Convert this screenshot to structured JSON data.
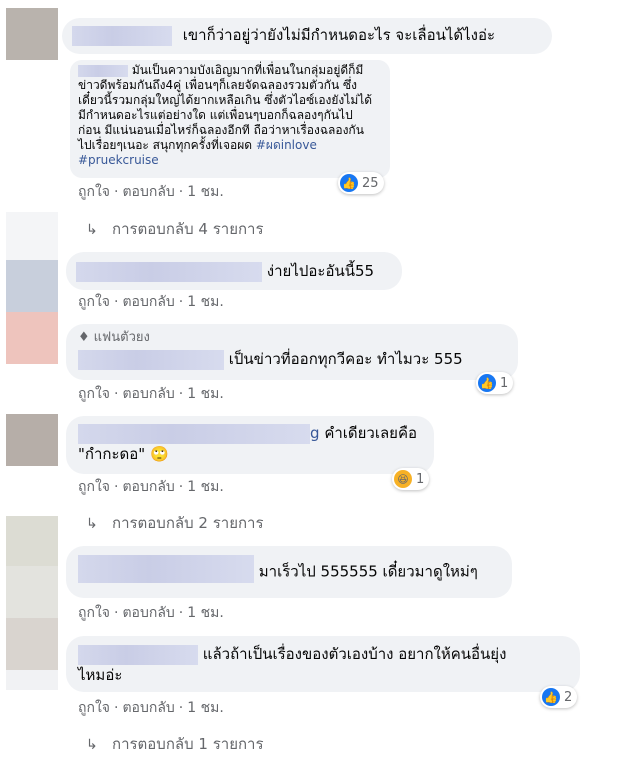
{
  "comments": [
    {
      "text": "เขาก็ว่าอยู่ว่ายังไม่มีกำหนดอะไร จะเลื่อนได้ไงอ่ะ"
    },
    {
      "text_lines": [
        "มันเป็นความบังเอิญมากที่เพื่อนในกลุ่มอยู่ดีก็มี",
        "ข่าวดีพร้อมกันถึง4คู่ เพื่อนๆก็เลยจัดฉลองรวมตัวกัน ซึ่ง",
        "เดี๋ยวนี้รวมกลุ่มใหญ่ได้ยากเหลือเกิน ซึ่งตัวไอซ์เองยังไม่ได้",
        "มีกำหนดอะไรแต่อย่างใด แต่เพื่อนๆบอกก็ฉลองๆกันไป",
        "ก่อน มีแน่นอนเมื่อไหร่ก็ฉลองอีกที ถือว่าหาเรื่องฉลองกัน",
        "ไปเรื่อยๆเนอะ สนุกทุกครั้งที่เจอผด"
      ],
      "hashtag1": "#ผดinlove",
      "hashtag2": "#pruekcruise",
      "reaction_count": "25",
      "reply_count_label": "การตอบกลับ 4 รายการ"
    },
    {
      "text": "ง่ายไปอะอันนี้55"
    },
    {
      "badge": "แฟนตัวยง",
      "text": "เป็นข่าวที่ออกทุกวีคอะ ทำไมวะ 555",
      "reaction_count": "1"
    },
    {
      "text_suffix": "g",
      "text_line1": "คำเดียวเลยคือ",
      "text_line2": "\"กำกะดอ\" 🙄",
      "reaction_count": "1",
      "reply_count_label": "การตอบกลับ 2 รายการ"
    },
    {
      "text": "มาเร็วไป 555555 เดี๋ยวมาดูใหม่ๆ"
    },
    {
      "text_line1": "แล้วถ้าเป็นเรื่องของตัวเองบ้าง อยากให้คนอื่นยุ่ง",
      "text_line2": "ไหมอ่ะ",
      "reaction_count": "2",
      "reply_count_label": "การตอบกลับ 1 รายการ"
    }
  ],
  "actions": {
    "like": "ถูกใจ",
    "reply": "ตอบกลับ",
    "time": "1 ชม."
  },
  "colors": {
    "like_blue": "#1877f2",
    "bubble_bg": "#f0f2f5",
    "meta_gray": "#65676b"
  }
}
